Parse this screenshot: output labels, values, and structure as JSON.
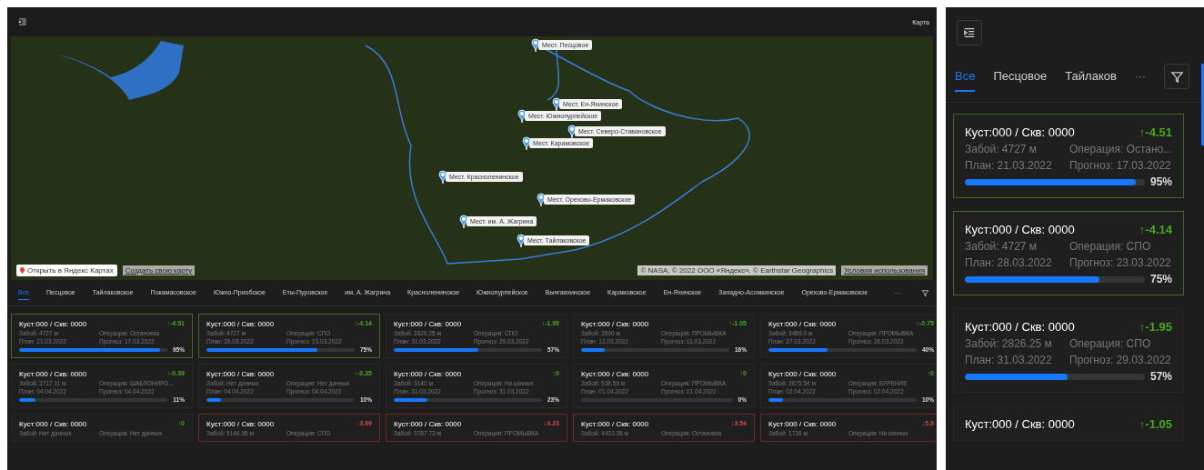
{
  "header": {
    "title": "Карта"
  },
  "map": {
    "markers": [
      "Мест. Песцовое",
      "Мест. Ен-Яхинское",
      "Мест. Южнопурпейское",
      "Мест. Северо-Ставановское",
      "Мест. Карамовское",
      "Мест. Красноленинское",
      "Мест. Орехово-Ермаковское",
      "Мест. им. А. Жагрина",
      "Мест. Тайлаковское"
    ],
    "open_button": "Открыть в Яндекс Картах",
    "create_link": "Создать свою карту",
    "copyright": "© NASA, © 2022 ООО «Яндекс», © Earthstar Geographics",
    "terms_link": "Условия использования"
  },
  "tabs": [
    {
      "label": "Все",
      "selected": true
    },
    {
      "label": "Песцовое",
      "selected": false
    },
    {
      "label": "Тайлаковское",
      "selected": false
    },
    {
      "label": "Покамасовское",
      "selected": false
    },
    {
      "label": "Южно-Приобское",
      "selected": false
    },
    {
      "label": "Еты-Пуровское",
      "selected": false
    },
    {
      "label": "им. А. Жагрина",
      "selected": false
    },
    {
      "label": "Красноленинское",
      "selected": false
    },
    {
      "label": "Южнопурпейское",
      "selected": false
    },
    {
      "label": "Вынгаяхинское",
      "selected": false
    },
    {
      "label": "Карамовское",
      "selected": false
    },
    {
      "label": "Ен-Яхинское",
      "selected": false
    },
    {
      "label": "Западно-Асомкинское",
      "selected": false
    },
    {
      "label": "Орехово-Ермаковское",
      "selected": false
    }
  ],
  "more": "···",
  "cards": [
    {
      "title": "Куст:000 / Скв: 0000",
      "delta": "↑-4.51",
      "rising": true,
      "flagged": true,
      "depth": "Забой: 4727 м",
      "operation": "Операция: Остановка",
      "plan": "План: 21.03.2022",
      "forecast": "Прогноз: 17.03.2022",
      "level": 0.95,
      "percent": "95%"
    },
    {
      "title": "Куст:000 / Скв: 0000",
      "delta": "↑-4.14",
      "rising": true,
      "flagged": true,
      "depth": "Забой: 4727 м",
      "operation": "Операция: СПО",
      "plan": "План: 28.03.2022",
      "forecast": "Прогноз: 23.03.2022",
      "level": 0.75,
      "percent": "75%"
    },
    {
      "title": "Куст:000 / Скв: 0000",
      "delta": "↑-1.95",
      "rising": true,
      "flagged": false,
      "depth": "Забой: 2826.25 м",
      "operation": "Операция: СПО",
      "plan": "План: 31.03.2022",
      "forecast": "Прогноз: 29.03.2022",
      "level": 0.57,
      "percent": "57%"
    },
    {
      "title": "Куст:000 / Скв: 0000",
      "delta": "↑-1.05",
      "rising": true,
      "flagged": false,
      "depth": "Забой: 3590 м",
      "operation": "Операция: ПРОМЫВКА",
      "plan": "План: 12.03.2022",
      "forecast": "Прогноз: 11.03.2022",
      "level": 0.16,
      "percent": "16%"
    },
    {
      "title": "Куст:000 / Скв: 0000",
      "delta": "↑-0.75",
      "rising": true,
      "flagged": false,
      "depth": "Забой: 3489.0 м",
      "operation": "Операция: ПРОМЫВКА",
      "plan": "План: 27.03.2022",
      "forecast": "Прогноз: 26.03.2022",
      "level": 0.4,
      "percent": "40%"
    },
    {
      "title": "Куст:000 / Скв: 0000",
      "delta": "↑-0.39",
      "rising": true,
      "flagged": false,
      "depth": "Забой: 3717.11 м",
      "operation": "Операция: ШАБЛОНИРО...",
      "plan": "План: 04.04.2022",
      "forecast": "Прогноз: 04.04.2022",
      "level": 0.11,
      "percent": "11%"
    },
    {
      "title": "Куст:000 / Скв: 0000",
      "delta": "↑-0.35",
      "rising": true,
      "flagged": false,
      "depth": "Забой: Нет данных",
      "operation": "Операция: Нет данных",
      "plan": "План: 04.04.2022",
      "forecast": "Прогноз: 04.04.2022",
      "level": 0.1,
      "percent": "10%"
    },
    {
      "title": "Куст:000 / Скв: 0000",
      "delta": "↑0",
      "rising": true,
      "flagged": false,
      "depth": "Забой: 3140 м",
      "operation": "Операция: На канных",
      "plan": "План: 31.03.2022",
      "forecast": "Прогноз: 31.03.2022",
      "level": 0.23,
      "percent": "23%"
    },
    {
      "title": "Куст:000 / Скв: 0000",
      "delta": "↑0",
      "rising": true,
      "flagged": false,
      "depth": "Забой: 938.59 м",
      "operation": "Операция: ПРОМЫВКА",
      "plan": "План: 01.04.2022",
      "forecast": "Прогноз: 01.04.2022",
      "level": 0,
      "percent": "0%"
    },
    {
      "title": "Куст:000 / Скв: 0000",
      "delta": "↑0",
      "rising": true,
      "flagged": false,
      "depth": "Забой: 3675.54 м",
      "operation": "Операция: БУРЕНИЕ",
      "plan": "План: 02.04.2022",
      "forecast": "Прогноз: 02.04.2022",
      "level": 0.1,
      "percent": "10%"
    },
    {
      "title": "Куст:000 / Скв: 0000",
      "delta": "↑0",
      "rising": true,
      "flagged": false,
      "depth": "Забой: Нет данных",
      "operation": "Операция: Нет данных"
    },
    {
      "title": "Куст:000 / Скв: 0000",
      "delta": "↓3.99",
      "rising": false,
      "flagged": true,
      "depth": "Забой: 5146.95 м",
      "operation": "Операция: СПО"
    },
    {
      "title": "Куст:000 / Скв: 0000",
      "delta": "↓4.23",
      "rising": false,
      "flagged": true,
      "depth": "Забой: 3787.73 м",
      "operation": "Операция: ПРОМЫВКА"
    },
    {
      "title": "Куст:000 / Скв: 0000",
      "delta": "↓3.54",
      "rising": false,
      "flagged": true,
      "depth": "Забой: 4433.05 м",
      "operation": "Операция: Остановка"
    },
    {
      "title": "Куст:000 / Скв: 0000",
      "delta": "↓5.9",
      "rising": false,
      "flagged": true,
      "depth": "Забой: 1736 м",
      "operation": "Операция: На канных"
    }
  ],
  "mobile": {
    "tabs": [
      {
        "label": "Все",
        "selected": true
      },
      {
        "label": "Песцовое",
        "selected": false
      },
      {
        "label": "Тайлаков",
        "selected": false
      }
    ],
    "more": "···",
    "cards": [
      {
        "title": "Куст:000 / Скв: 0000",
        "delta": "↑-4.51",
        "rising": true,
        "flagged": true,
        "depth": "Забой: 4727 м",
        "operation": "Операция: Остано...",
        "plan": "План: 21.03.2022",
        "forecast": "Прогноз: 17.03.2022",
        "level": 0.95,
        "percent": "95%"
      },
      {
        "title": "Куст:000 / Скв: 0000",
        "delta": "↑-4.14",
        "rising": true,
        "flagged": true,
        "depth": "Забой: 4727 м",
        "operation": "Операция: СПО",
        "plan": "План: 28.03.2022",
        "forecast": "Прогноз: 23.03.2022",
        "level": 0.75,
        "percent": "75%"
      },
      {
        "title": "Куст:000 / Скв: 0000",
        "delta": "↑-1.95",
        "rising": true,
        "flagged": false,
        "depth": "Забой: 2826.25 м",
        "operation": "Операция: СПО",
        "plan": "План: 31.03.2022",
        "forecast": "Прогноз: 29.03.2022",
        "level": 0.57,
        "percent": "57%"
      },
      {
        "title": "Куст:000 / Скв: 0000",
        "delta": "↑-1.05",
        "rising": true,
        "flagged": false
      }
    ]
  }
}
